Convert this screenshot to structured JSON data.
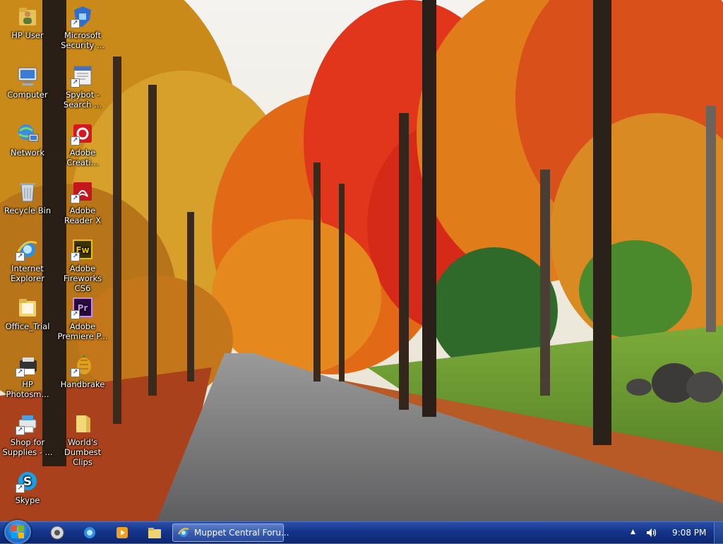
{
  "desktop": {
    "icons": [
      {
        "label": "HP User",
        "icon": "folder-user-icon"
      },
      {
        "label": "Microsoft Security ...",
        "icon": "shield-icon"
      },
      {
        "label": "Computer",
        "icon": "computer-icon"
      },
      {
        "label": "Spybot - Search ...",
        "icon": "spybot-icon"
      },
      {
        "label": "Network",
        "icon": "network-icon"
      },
      {
        "label": "Adobe Creati...",
        "icon": "adobe-cc-icon"
      },
      {
        "label": "Recycle Bin",
        "icon": "recycle-bin-icon"
      },
      {
        "label": "Adobe Reader X",
        "icon": "adobe-reader-icon"
      },
      {
        "label": "Internet Explorer",
        "icon": "ie-icon"
      },
      {
        "label": "Adobe Fireworks CS6",
        "icon": "fireworks-icon"
      },
      {
        "label": "Office_Trial",
        "icon": "folder-icon"
      },
      {
        "label": "Adobe Premiere P...",
        "icon": "premiere-icon"
      },
      {
        "label": "HP Photosm...",
        "icon": "hp-photosmart-icon"
      },
      {
        "label": "Handbrake",
        "icon": "handbrake-icon"
      },
      {
        "label": "Shop for Supplies - ...",
        "icon": "printer-icon"
      },
      {
        "label": "World's Dumbest Clips",
        "icon": "folder-icon"
      },
      {
        "label": "Skype",
        "icon": "skype-icon"
      }
    ]
  },
  "taskbar": {
    "task_button_label": "Muppet Central Foru...",
    "clock": "9:08 PM",
    "tray_chevron": "▲"
  },
  "colors": {
    "taskbar": "#14348a",
    "accent": "#1f6fd1"
  }
}
